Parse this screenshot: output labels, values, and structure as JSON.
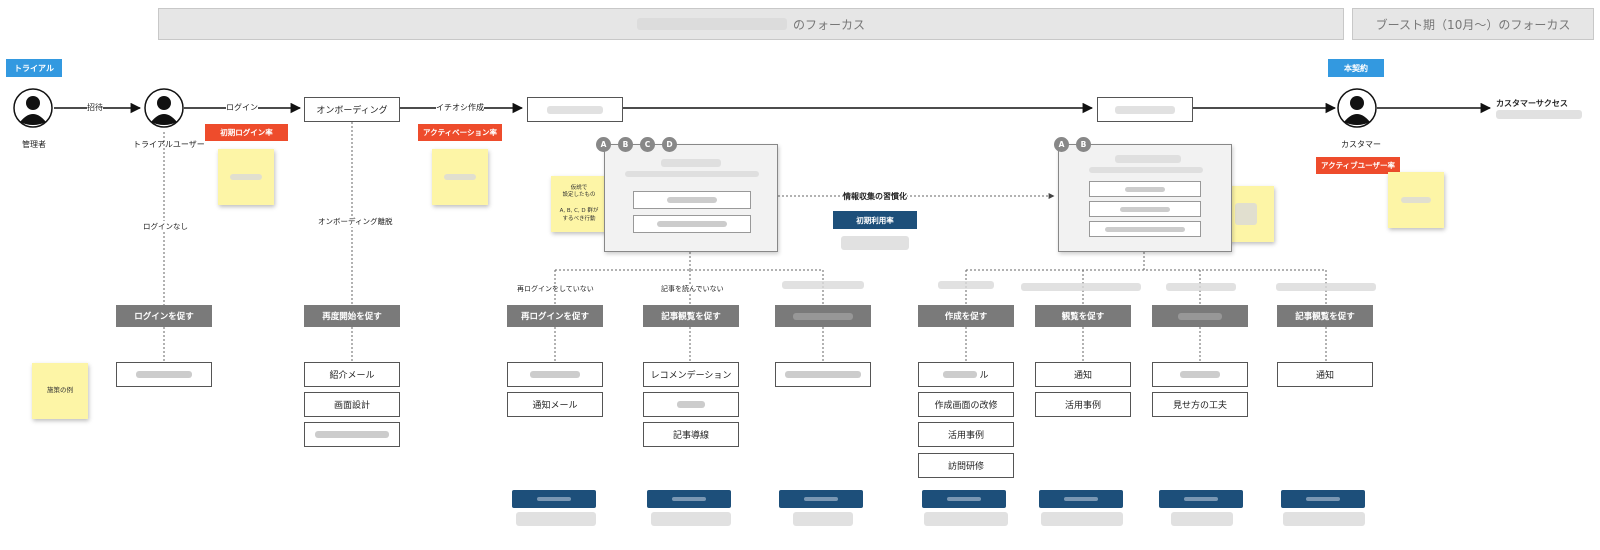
{
  "banners": {
    "left_suffix": "のフォーカス",
    "right": "ブースト期（10月〜）のフォーカス"
  },
  "tags": {
    "trial": "トライアル",
    "contract": "本契約"
  },
  "actors": {
    "admin": "管理者",
    "trial_user": "トライアルユーザー",
    "customer": "カスタマー",
    "success": "カスタマーサクセス"
  },
  "flow": {
    "invite": "招待",
    "login": "ログイン",
    "onboarding": "オンボーディング",
    "ichioshi": "イチオシ作成",
    "info_habit": "情報収集の習慣化"
  },
  "metrics": {
    "first_login_rate": "初期ログイン率",
    "activation_rate": "アクティベーション率",
    "initial_use_rate": "初期利用率",
    "active_user_rate": "アクティブユーザー率"
  },
  "circles_left": [
    "A",
    "B",
    "C",
    "D"
  ],
  "circles_right": [
    "A",
    "B"
  ],
  "sticky": {
    "hypothesis": "仮説で\n設定したもの\n\nA, B, C, D 群が\nするべき行動",
    "example": "施策の例"
  },
  "branches": {
    "no_login": "ログインなし",
    "onboarding_drop": "オンボーディング離脱",
    "not_relogin": "再ログインをしていない",
    "not_read": "記事を読んでいない"
  },
  "actions": {
    "promote_login": "ログインを促す",
    "promote_restart": "再度開始を促す",
    "promote_relogin": "再ログインを促す",
    "promote_read_1": "記事観覧を促す",
    "promote_create": "作成を促す",
    "promote_view": "観覧を促す",
    "promote_read_2": "記事観覧を促す"
  },
  "measures": {
    "intro_mail": "紹介メール",
    "screen_design": "画面設計",
    "notify_mail": "通知メール",
    "recommendation": "レコメンデーション",
    "article_flow": "記事導線",
    "create_screen": "作成画面の改修",
    "use_case_1": "活用事例",
    "visit_training": "訪問研修",
    "notify_1": "通知",
    "use_case_2": "活用事例",
    "show_design": "見せ方の工夫",
    "notify_2": "通知",
    "rule_suffix": "ル"
  },
  "colors": {
    "accent_blue": "#3399e0",
    "metric_red": "#ee4c2c",
    "metric_navy": "#1d4f7a",
    "action_gray": "#7a7a7a",
    "sticky_yellow": "#fdf5a6"
  }
}
